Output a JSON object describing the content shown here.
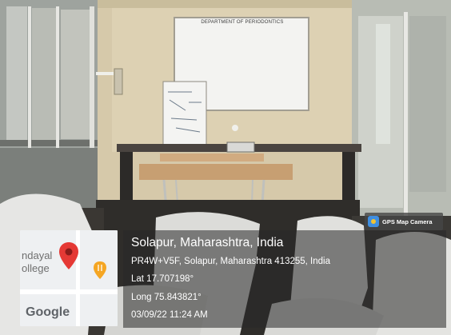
{
  "scene": {
    "board_title": "DEPARTMENT OF PERIODONTICS"
  },
  "badge": {
    "app_name": "GPS Map Camera",
    "icon": "gps-map-camera-icon"
  },
  "map": {
    "place_label_line1": "ndayal",
    "place_label_line2": "ollege",
    "brand": "Google",
    "pin_icon": "map-pin-icon",
    "poi_icon": "restaurant-icon",
    "pin_color": "#e53935",
    "poi_color": "#f5a623"
  },
  "location": {
    "city_line": "Solapur, Maharashtra, India",
    "address": "PR4W+V5F, Solapur, Maharashtra 413255, India",
    "latitude": "Lat 17.707198°",
    "longitude": "Long 75.843821°",
    "datetime": "03/09/22 11:24 AM"
  }
}
